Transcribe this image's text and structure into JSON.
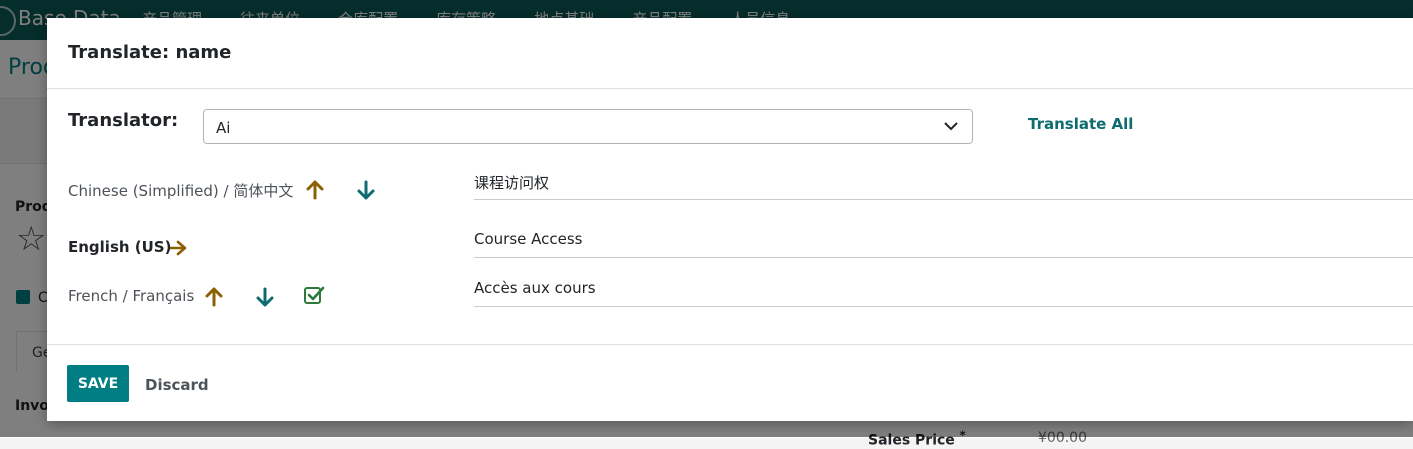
{
  "app": {
    "brand": "Base Data",
    "menus": [
      "产品管理",
      "往来单位",
      "仓库配置",
      "库存策略",
      "地点基础",
      "产品配置",
      "人员信息"
    ],
    "breadcrumb": "Prod",
    "bg_label_prod": "Prod",
    "bg_label_inv": "Invo",
    "bg_tab": "Ge",
    "bg_check_label": "C",
    "sales_price_label": "Sales Price",
    "sales_price_required": "*",
    "sales_price_value": "¥00.00"
  },
  "dialog": {
    "title": "Translate: name",
    "translator_label": "Translator:",
    "translator_value": "Ai",
    "translate_all": "Translate All",
    "languages": [
      {
        "label": "Chinese (Simplified) / 简体中文",
        "value": "课程访问权",
        "current": false,
        "up": true,
        "down": true,
        "check": false
      },
      {
        "label": "English (US)",
        "value": "Course Access",
        "current": true,
        "up": false,
        "down": false,
        "check": false
      },
      {
        "label": "French / Français",
        "value": "Accès aux cours",
        "current": false,
        "up": true,
        "down": true,
        "check": true
      }
    ],
    "save_label": "SAVE",
    "discard_label": "Discard"
  },
  "colors": {
    "primary": "#017e84",
    "arrow_up": "#8a6100",
    "arrow_down": "#0e6b6f",
    "check": "#2b7a3b"
  }
}
